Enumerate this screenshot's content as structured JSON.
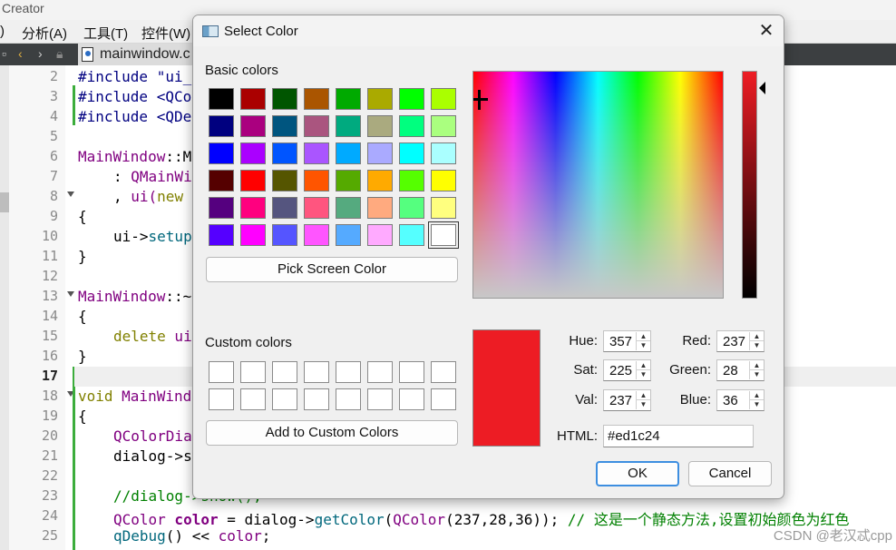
{
  "ide": {
    "window_title": "Creator",
    "menus": [
      ")",
      "分析(A)",
      "工具(T)",
      "控件(W)"
    ],
    "tab_label": "mainwindow.c",
    "line_numbers": [
      "2",
      "3",
      "4",
      "5",
      "6",
      "7",
      "8",
      "9",
      "10",
      "11",
      "12",
      "13",
      "14",
      "15",
      "16",
      "17",
      "18",
      "19",
      "20",
      "21",
      "22",
      "23",
      "24",
      "25"
    ],
    "current_line": "17",
    "code": {
      "l2": "#include \"ui_",
      "l3": "#include <QCo",
      "l4": "#include <QDe",
      "l6a": "MainWindow",
      "l6b": "::M",
      "l7a": ": ",
      "l7b": "QMainWi",
      "l8a": ", ",
      "l8b": "ui(",
      "l8c": "new",
      "l9": "{",
      "l10a": "ui->",
      "l10b": "setup",
      "l11": "}",
      "l13a": "MainWindow",
      "l13b": "::~",
      "l14": "{",
      "l15a": "delete",
      "l15b": " ui",
      "l16": "}",
      "l18a": "void",
      "l18b": " MainWind",
      "l19": "{",
      "l20": "QColorDia",
      "l21": "dialog->s",
      "l22": "",
      "l23": "//dialog->show();",
      "l24a": "QColor",
      "l24b": " color",
      "l24c": " = dialog->",
      "l24d": "getColor",
      "l24e": "(",
      "l24f": "QColor",
      "l24g": "(237,28,36)); ",
      "l24h": "// 这是一个静态方法,设置初始颜色为红色",
      "l25a": "qDebug",
      "l25b": "() << ",
      "l25c": "color",
      "l25d": ";"
    },
    "watermark": "CSDN @老汉忒cpp"
  },
  "dialog": {
    "title": "Select Color",
    "close_glyph": "✕",
    "basic_colors_label": "Basic colors",
    "basic_colors": [
      [
        "#000000",
        "#aa0000",
        "#005500",
        "#aa5500",
        "#00aa00",
        "#aaaa00",
        "#00ff00",
        "#aaff00"
      ],
      [
        "#00007f",
        "#aa007f",
        "#00557f",
        "#aa557f",
        "#00aa7f",
        "#aaaa7f",
        "#00ff7f",
        "#aaff7f"
      ],
      [
        "#0000ff",
        "#aa00ff",
        "#0055ff",
        "#aa55ff",
        "#00aaff",
        "#aaaaff",
        "#00ffff",
        "#aaffff"
      ],
      [
        "#550000",
        "#ff0000",
        "#555500",
        "#ff5500",
        "#55aa00",
        "#ffaa00",
        "#55ff00",
        "#ffff00"
      ],
      [
        "#55007f",
        "#ff007f",
        "#55557f",
        "#ff557f",
        "#55aa7f",
        "#ffaa7f",
        "#55ff7f",
        "#ffff7f"
      ],
      [
        "#5500ff",
        "#ff00ff",
        "#5555ff",
        "#ff55ff",
        "#55aaff",
        "#ffaaff",
        "#55ffff",
        "#ffffff"
      ]
    ],
    "selected_basic": [
      5,
      7
    ],
    "pick_screen_label": "Pick Screen Color",
    "custom_colors_label": "Custom colors",
    "add_custom_label": "Add to Custom Colors",
    "current_color": "#ed1c24",
    "fields": {
      "hue_label": "Hue:",
      "hue": "357",
      "sat_label": "Sat:",
      "sat": "225",
      "val_label": "Val:",
      "val": "237",
      "red_label": "Red:",
      "red": "237",
      "green_label": "Green:",
      "green": "28",
      "blue_label": "Blue:",
      "blue": "36",
      "html_label": "HTML:",
      "html": "#ed1c24"
    },
    "ok_label": "OK",
    "cancel_label": "Cancel"
  }
}
